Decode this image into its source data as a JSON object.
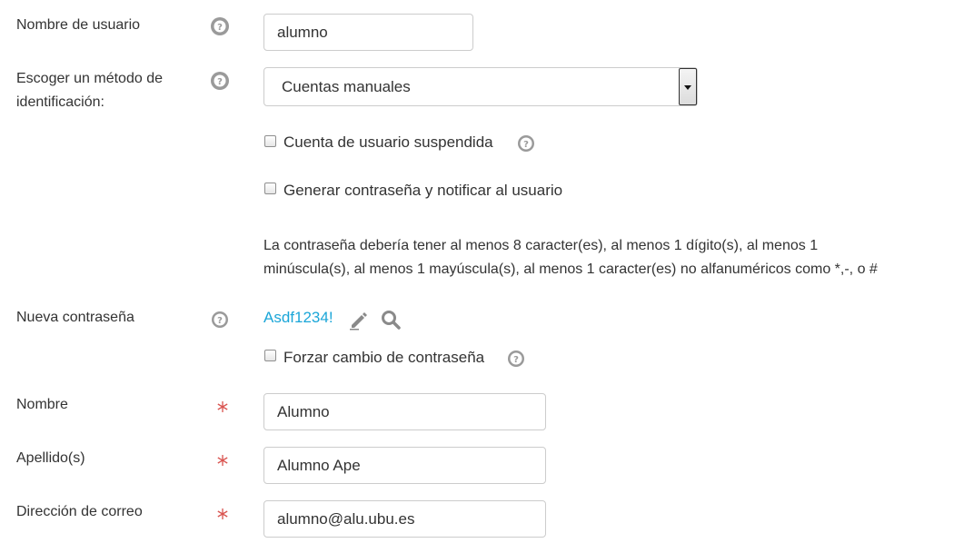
{
  "username": {
    "label": "Nombre de usuario",
    "value": "alumno",
    "help_icon": "question-circle-icon"
  },
  "auth_method": {
    "label_line1": "Escoger un método de",
    "label_line2": "identificación:",
    "selected": "Cuentas manuales",
    "help_icon": "question-circle-icon"
  },
  "suspended": {
    "label": "Cuenta de usuario suspendida",
    "checked": false,
    "help_icon": "question-circle-icon"
  },
  "generate_password": {
    "label": "Generar contraseña y notificar al usuario",
    "checked": false
  },
  "password_policy": {
    "line1": "La contraseña debería tener al menos 8 caracter(es), al menos 1 dígito(s), al menos 1",
    "line2": "minúscula(s), al menos 1 mayúscula(s), al menos 1 caracter(es) no alfanuméricos como *,-, o #"
  },
  "new_password": {
    "label": "Nueva contraseña",
    "value": "Asdf1234!",
    "edit_icon": "pencil-icon",
    "reveal_icon": "magnifier-icon",
    "help_icon": "question-circle-icon"
  },
  "force_change": {
    "label": "Forzar cambio de contraseña",
    "checked": false,
    "help_icon": "question-circle-icon"
  },
  "first_name": {
    "label": "Nombre",
    "value": "Alumno",
    "required_icon": "asterisk-icon"
  },
  "last_name": {
    "label": "Apellido(s)",
    "value": "Alumno Ape",
    "required_icon": "asterisk-icon"
  },
  "email": {
    "label": "Dirección de correo",
    "value": "alumno@alu.ubu.es",
    "required_icon": "asterisk-icon"
  },
  "colors": {
    "text": "#333333",
    "link": "#1ba6d8",
    "required": "#d9534f",
    "help": "#9a9a9a",
    "border": "#cccccc"
  }
}
